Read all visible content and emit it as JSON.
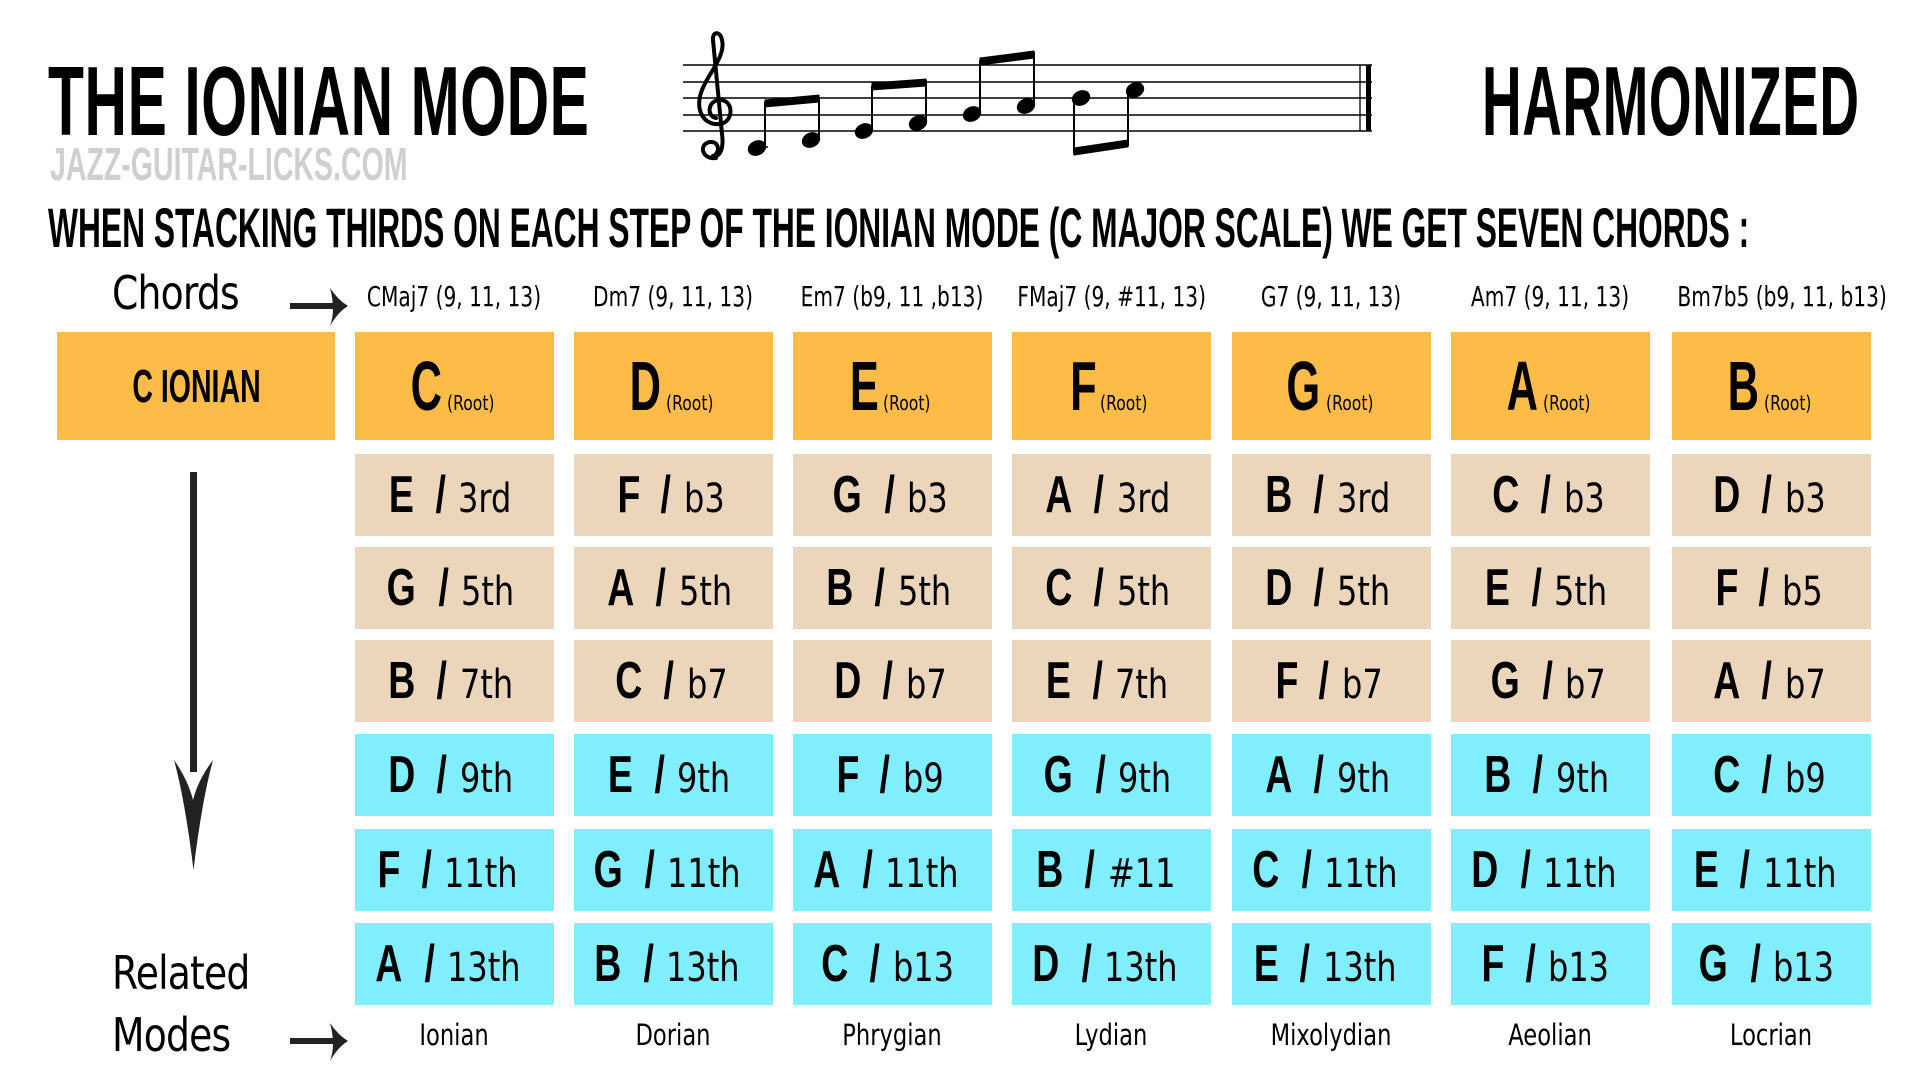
{
  "header": {
    "title_left": "THE IONIAN MODE",
    "title_right": "HARMONIZED",
    "watermark": "JAZZ-GUITAR-LICKS.COM",
    "subtitle": "WHEN STACKING THIRDS ON EACH STEP OF THE IONIAN MODE (C MAJOR SCALE) WE GET SEVEN CHORDS :"
  },
  "staff": {
    "clef": "treble",
    "notes": [
      "C4",
      "D4",
      "E4",
      "F4",
      "G4",
      "A4",
      "B4",
      "C5"
    ]
  },
  "labels": {
    "chords": "Chords",
    "related_line1": "Related",
    "related_line2": "Modes",
    "scale_name": "C IONIAN",
    "root_tag": "(Root)"
  },
  "colors": {
    "root_row": "#FCBC47",
    "triad_rows": "#EBD5BB",
    "extension_rows": "#80EEFC",
    "watermark": "#CFCFCF"
  },
  "table": {
    "columns": [
      {
        "chord": "CMaj7 (9, 11, 13)",
        "root": "C",
        "mode": "Ionian",
        "tones": [
          {
            "note": "E",
            "interval": "3rd"
          },
          {
            "note": "G",
            "interval": "5th"
          },
          {
            "note": "B",
            "interval": "7th"
          },
          {
            "note": "D",
            "interval": "9th"
          },
          {
            "note": "F",
            "interval": "11th"
          },
          {
            "note": "A",
            "interval": "13th"
          }
        ]
      },
      {
        "chord": "Dm7 (9, 11, 13)",
        "root": "D",
        "mode": "Dorian",
        "tones": [
          {
            "note": "F",
            "interval": "b3"
          },
          {
            "note": "A",
            "interval": "5th"
          },
          {
            "note": "C",
            "interval": "b7"
          },
          {
            "note": "E",
            "interval": "9th"
          },
          {
            "note": "G",
            "interval": "11th"
          },
          {
            "note": "B",
            "interval": "13th"
          }
        ]
      },
      {
        "chord": "Em7 (b9, 11 ,b13)",
        "root": "E",
        "mode": "Phrygian",
        "tones": [
          {
            "note": "G",
            "interval": "b3"
          },
          {
            "note": "B",
            "interval": "5th"
          },
          {
            "note": "D",
            "interval": "b7"
          },
          {
            "note": "F",
            "interval": "b9"
          },
          {
            "note": "A",
            "interval": "11th"
          },
          {
            "note": "C",
            "interval": "b13"
          }
        ]
      },
      {
        "chord": "FMaj7 (9, #11, 13)",
        "root": "F",
        "mode": "Lydian",
        "tones": [
          {
            "note": "A",
            "interval": "3rd"
          },
          {
            "note": "C",
            "interval": "5th"
          },
          {
            "note": "E",
            "interval": "7th"
          },
          {
            "note": "G",
            "interval": "9th"
          },
          {
            "note": "B",
            "interval": "#11"
          },
          {
            "note": "D",
            "interval": "13th"
          }
        ]
      },
      {
        "chord": "G7 (9, 11, 13)",
        "root": "G",
        "mode": "Mixolydian",
        "tones": [
          {
            "note": "B",
            "interval": "3rd"
          },
          {
            "note": "D",
            "interval": "5th"
          },
          {
            "note": "F",
            "interval": "b7"
          },
          {
            "note": "A",
            "interval": "9th"
          },
          {
            "note": "C",
            "interval": "11th"
          },
          {
            "note": "E",
            "interval": "13th"
          }
        ]
      },
      {
        "chord": "Am7 (9, 11, 13)",
        "root": "A",
        "mode": "Aeolian",
        "tones": [
          {
            "note": "C",
            "interval": "b3"
          },
          {
            "note": "E",
            "interval": "5th"
          },
          {
            "note": "G",
            "interval": "b7"
          },
          {
            "note": "B",
            "interval": "9th"
          },
          {
            "note": "D",
            "interval": "11th"
          },
          {
            "note": "F",
            "interval": "b13"
          }
        ]
      },
      {
        "chord": "Bm7b5 (b9, 11, b13)",
        "root": "B",
        "mode": "Locrian",
        "tones": [
          {
            "note": "D",
            "interval": "b3"
          },
          {
            "note": "F",
            "interval": "b5"
          },
          {
            "note": "A",
            "interval": "b7"
          },
          {
            "note": "C",
            "interval": "b9"
          },
          {
            "note": "E",
            "interval": "11th"
          },
          {
            "note": "G",
            "interval": "b13"
          }
        ]
      }
    ]
  }
}
